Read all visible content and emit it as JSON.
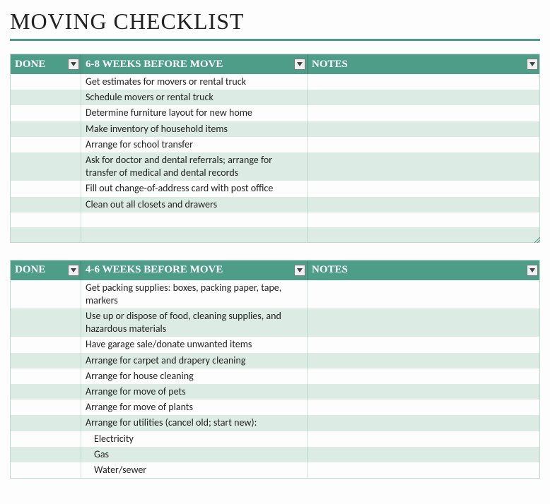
{
  "title": "MOVING CHECKLIST",
  "columns": {
    "done": "DONE",
    "notes": "NOTES"
  },
  "sections": [
    {
      "heading": "6-8 WEEKS BEFORE MOVE",
      "rows": [
        {
          "task": "Get estimates for movers or rental truck",
          "indent": false
        },
        {
          "task": "Schedule movers or rental truck",
          "indent": false
        },
        {
          "task": "Determine furniture layout for new home",
          "indent": false
        },
        {
          "task": "Make inventory of household items",
          "indent": false
        },
        {
          "task": "Arrange for school transfer",
          "indent": false
        },
        {
          "task": "Ask for doctor and dental referrals; arrange for transfer of medical and dental records",
          "indent": false
        },
        {
          "task": "Fill out change-of-address card with post office",
          "indent": false
        },
        {
          "task": "Clean out all closets and drawers",
          "indent": false
        },
        {
          "task": "",
          "indent": false
        },
        {
          "task": "",
          "indent": false
        }
      ]
    },
    {
      "heading": "4-6 WEEKS BEFORE MOVE",
      "rows": [
        {
          "task": "Get packing supplies: boxes, packing paper, tape, markers",
          "indent": false
        },
        {
          "task": "Use up or dispose of food, cleaning supplies, and hazardous materials",
          "indent": false
        },
        {
          "task": "Have garage sale/donate unwanted items",
          "indent": false
        },
        {
          "task": "Arrange for carpet and drapery cleaning",
          "indent": false
        },
        {
          "task": "Arrange for house cleaning",
          "indent": false
        },
        {
          "task": "Arrange for move of pets",
          "indent": false
        },
        {
          "task": "Arrange for move of plants",
          "indent": false
        },
        {
          "task": "Arrange for utilities (cancel old; start new):",
          "indent": false
        },
        {
          "task": "Electricity",
          "indent": true
        },
        {
          "task": "Gas",
          "indent": true
        },
        {
          "task": "Water/sewer",
          "indent": true
        }
      ]
    }
  ]
}
